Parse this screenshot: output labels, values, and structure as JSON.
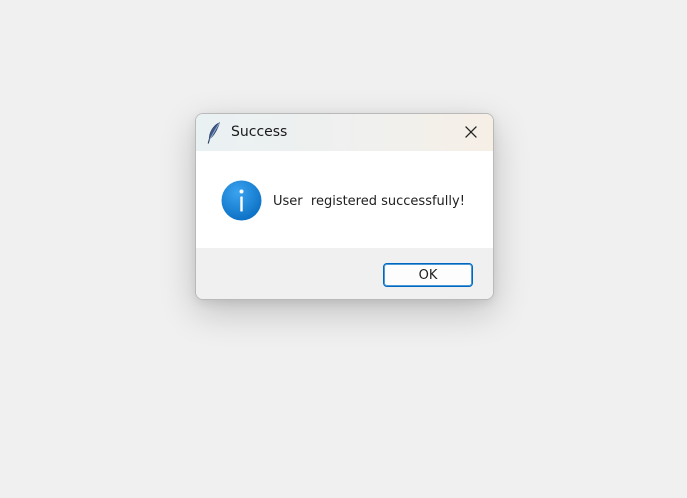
{
  "dialog": {
    "title": "Success",
    "icon": "feather-icon",
    "close_icon": "close-icon",
    "message_icon": "info-icon",
    "message": "User  registered successfully!",
    "ok_label": "OK",
    "accent_color": "#0067c0",
    "info_color": "#1a86d9"
  }
}
